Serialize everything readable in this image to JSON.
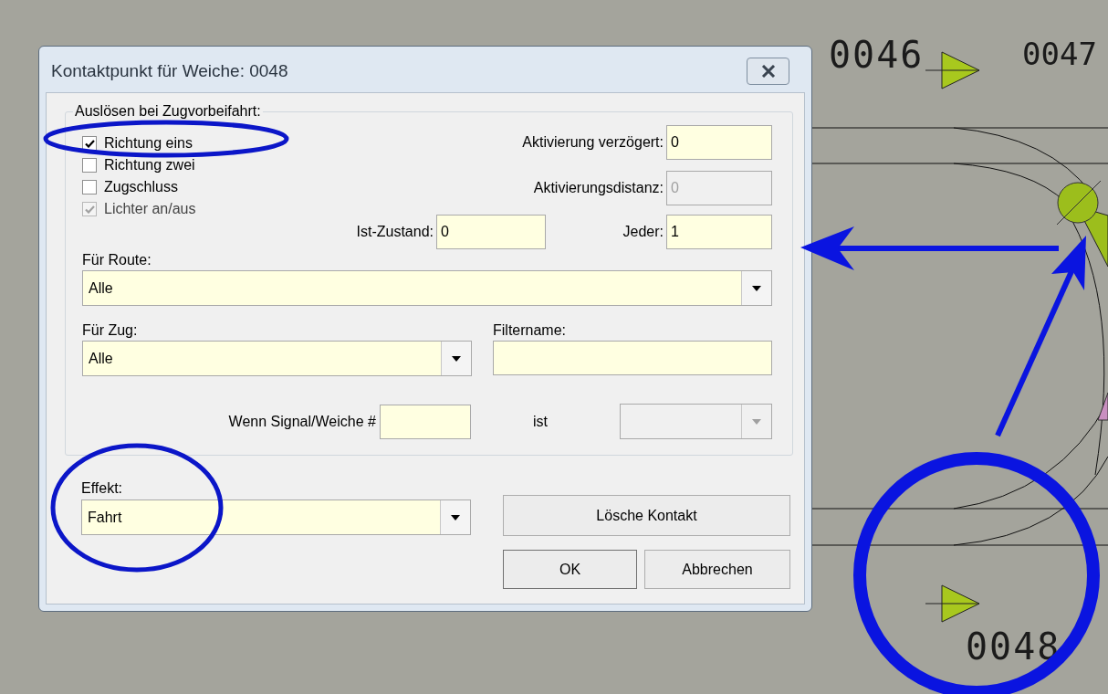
{
  "window": {
    "title": "Kontaktpunkt für Weiche: 0048"
  },
  "trigger_group": {
    "label": "Auslösen bei Zugvorbeifahrt:",
    "checkboxes": [
      {
        "label": "Richtung eins",
        "checked": true,
        "disabled": false
      },
      {
        "label": "Richtung zwei",
        "checked": false,
        "disabled": false
      },
      {
        "label": "Zugschluss",
        "checked": false,
        "disabled": false
      },
      {
        "label": "Lichter an/aus",
        "checked": true,
        "disabled": true
      }
    ],
    "delay": {
      "label": "Aktivierung verzögert:",
      "value": "0",
      "disabled": false
    },
    "distance": {
      "label": "Aktivierungsdistanz:",
      "value": "0",
      "disabled": true
    },
    "state": {
      "label": "Ist-Zustand:",
      "value": "0",
      "disabled": false
    },
    "every": {
      "label": "Jeder:",
      "value": "1",
      "disabled": false
    },
    "route": {
      "label": "Für Route:",
      "value": "Alle",
      "disabled": false
    },
    "train": {
      "label": "Für Zug:",
      "value": "Alle",
      "disabled": false
    },
    "filter": {
      "label": "Filtername:",
      "disabled": false
    },
    "signal": {
      "label": "Wenn Signal/Weiche #",
      "disabled": false
    },
    "is": {
      "label": "ist",
      "disabled": true
    }
  },
  "effect": {
    "label": "Effekt:",
    "value": "Fahrt",
    "disabled": false
  },
  "buttons": [
    "Lösche Kontakt",
    "OK",
    "Abbrechen"
  ],
  "diagram": {
    "labels": [
      "0046",
      "0047",
      "0048"
    ]
  }
}
